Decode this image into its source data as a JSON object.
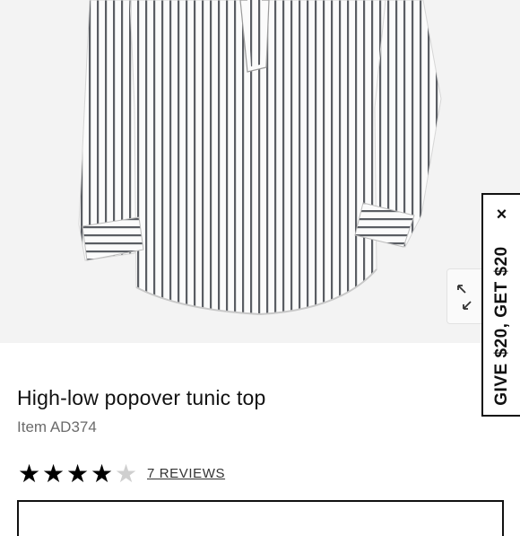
{
  "product": {
    "title": "High-low popover tunic top",
    "item_id": "Item AD374",
    "rating": {
      "value": 4,
      "max": 5
    },
    "reviews_link": "7 REVIEWS"
  },
  "image": {
    "expand_icon": "expand-arrows-icon"
  },
  "promo": {
    "label": "GIVE $20, GET $20",
    "close_label": "×"
  },
  "colors": {
    "stripe": "#5a5d63",
    "shirt_base": "#fbfbfb",
    "star_on": "#000000",
    "star_off": "#cfcfcf"
  }
}
